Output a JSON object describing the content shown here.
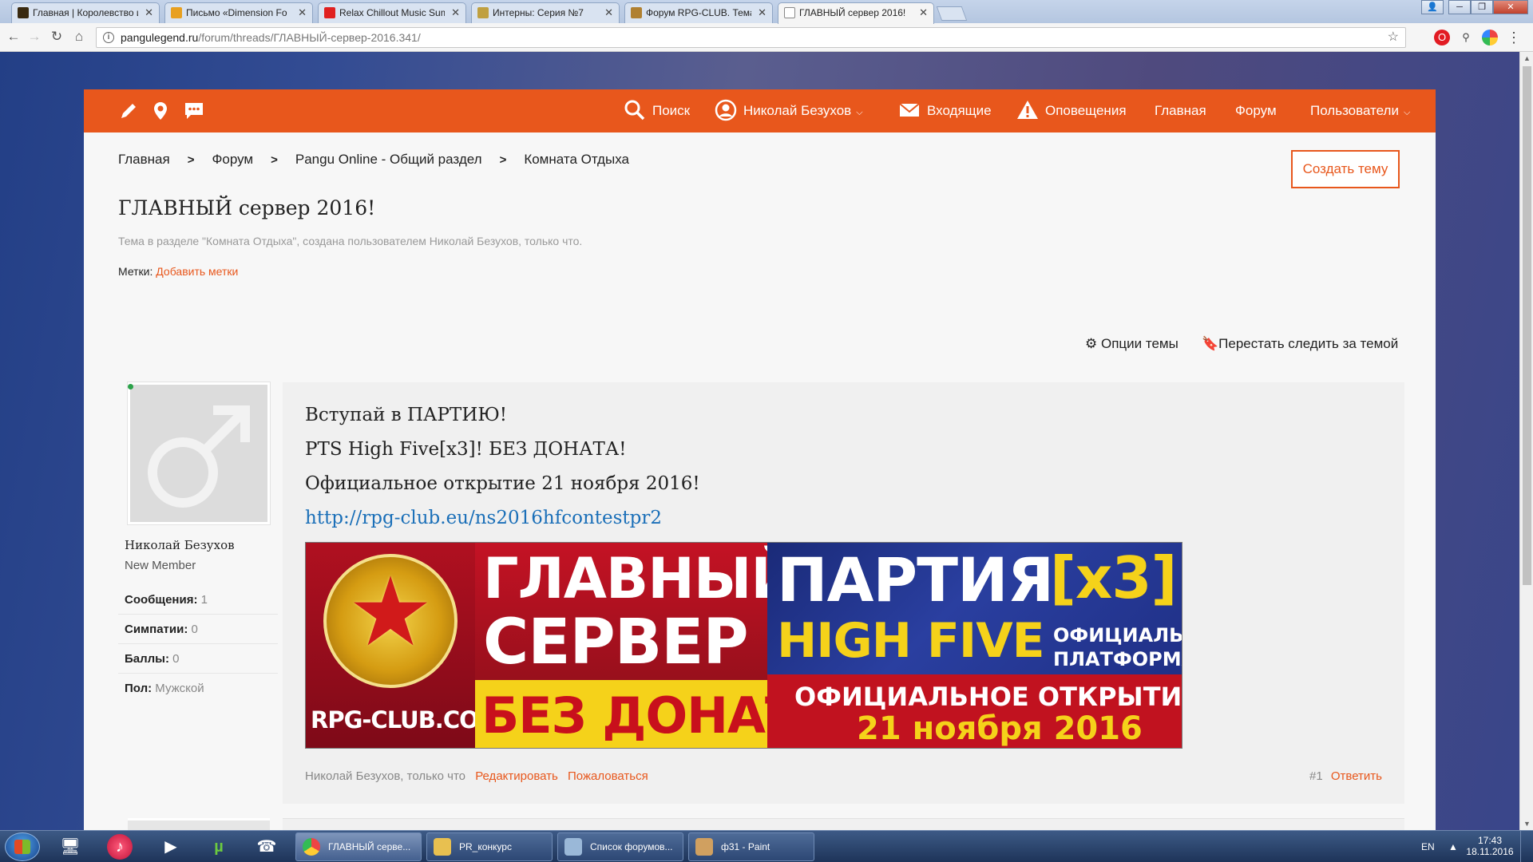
{
  "browser": {
    "tabs": [
      {
        "label": "Главная | Королевство и",
        "fav_color": "#3a2a10"
      },
      {
        "label": "Письмо «Dimension Fo",
        "fav_color": "#e8a020"
      },
      {
        "label": "Relax Chillout Music Sum",
        "fav_color": "#e02020"
      },
      {
        "label": "Интерны: Серия №7",
        "fav_color": "#c0a040"
      },
      {
        "label": "Форум RPG-CLUB. Тема",
        "fav_color": "#b08030"
      },
      {
        "label": "ГЛАВНЫЙ сервер 2016!",
        "fav_color": "#ffffff"
      }
    ],
    "url_host": "pangulegend.ru",
    "url_path": "/forum/threads/ГЛАВНЫЙ-сервер-2016.341/"
  },
  "nav": {
    "search": "Поиск",
    "user": "Николай Безухов",
    "inbox": "Входящие",
    "alerts": "Оповещения",
    "home": "Главная",
    "forum": "Форум",
    "users": "Пользователи"
  },
  "breadcrumbs": [
    "Главная",
    "Форум",
    "Pangu Online - Общий раздел",
    "Комната Отдыха"
  ],
  "create_thread": "Создать тему",
  "thread": {
    "title": "ГЛАВНЫЙ сервер 2016!",
    "meta": "Тема в разделе \"Комната Отдыха\", создана пользователем Николай Безухов, только что.",
    "tags_label": "Метки:",
    "tags_link": "Добавить метки",
    "options": "Опции темы",
    "unwatch": "Перестать следить за темой"
  },
  "author": {
    "name": "Николай Безухов",
    "title": "New Member",
    "stats": [
      {
        "label": "Сообщения:",
        "value": "1"
      },
      {
        "label": "Симпатии:",
        "value": "0"
      },
      {
        "label": "Баллы:",
        "value": "0"
      },
      {
        "label": "Пол:",
        "value": "Мужской"
      }
    ]
  },
  "post": {
    "line1": "Вступай в ПАРТИЮ!",
    "line2": "PTS High Five[x3]! БЕЗ ДОНАТА!",
    "line3": "Официальное открытие 21 ноября 2016!",
    "link": "http://rpg-club.eu/ns2016hfcontestpr2",
    "banner": {
      "site": "RPG-CLUB.COM",
      "main1": "ГЛАВНЫЙ",
      "main2": "СЕРВЕР",
      "nodonate": "БЕЗ ДОНАТА",
      "party": "ПАРТИЯ",
      "x3": "[x3]",
      "highfive": "HIGH FIVE",
      "official1": "ОФИЦИАЛЬНАЯ",
      "official2": "ПЛАТФОРМА",
      "opening": "ОФИЦИАЛЬНОЕ ОТКРЫТИЕ",
      "date": "21 ноября 2016"
    },
    "footer_author": "Николай Безухов, только что",
    "edit": "Редактировать",
    "report": "Пожаловаться",
    "number": "#1",
    "reply": "Ответить"
  },
  "taskbar": {
    "tasks": [
      {
        "label": "ГЛАВНЫЙ серве...",
        "color": "#e04030"
      },
      {
        "label": "PR_конкурс",
        "color": "#e8c050"
      },
      {
        "label": "Список форумов...",
        "color": "#9ab8d8"
      },
      {
        "label": "ф31 - Paint",
        "color": "#d0a060"
      }
    ],
    "lang": "EN",
    "time": "17:43",
    "date": "18.11.2016"
  }
}
